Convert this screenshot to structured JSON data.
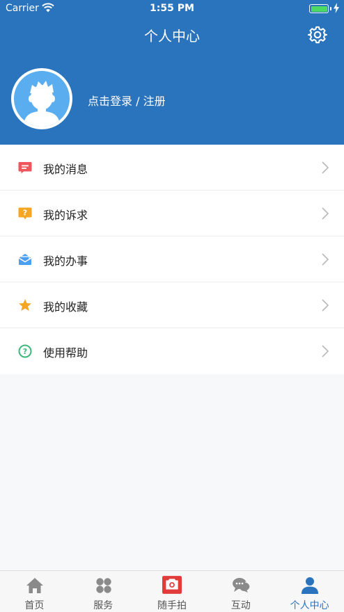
{
  "status_bar": {
    "carrier": "Carrier",
    "time": "1:55 PM"
  },
  "header": {
    "title": "个人中心",
    "login_prompt": "点击登录 / 注册"
  },
  "menu": {
    "items": [
      {
        "label": "我的消息",
        "icon": "message-icon",
        "color": "#f0575c"
      },
      {
        "label": "我的诉求",
        "icon": "question-box-icon",
        "color": "#f6a623"
      },
      {
        "label": "我的办事",
        "icon": "envelope-icon",
        "color": "#4a9ff0"
      },
      {
        "label": "我的收藏",
        "icon": "star-icon",
        "color": "#f6a623"
      },
      {
        "label": "使用帮助",
        "icon": "help-circle-icon",
        "color": "#3cb878"
      }
    ]
  },
  "tabbar": {
    "active_index": 4,
    "items": [
      {
        "label": "首页",
        "icon": "home-icon"
      },
      {
        "label": "服务",
        "icon": "grid-icon"
      },
      {
        "label": "随手拍",
        "icon": "camera-icon"
      },
      {
        "label": "互动",
        "icon": "chat-icon"
      },
      {
        "label": "个人中心",
        "icon": "person-icon"
      }
    ]
  },
  "colors": {
    "primary": "#2a73bd",
    "background": "#f7f8fa"
  }
}
